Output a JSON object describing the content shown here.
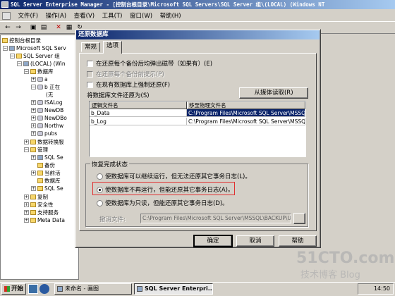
{
  "window": {
    "title": "SQL Server Enterprise Manager - [控制台根目录\\Microsoft SQL Servers\\SQL Server 组\\(LOCAL) (Windows NT"
  },
  "menu": [
    "文件(F)",
    "操作(A)",
    "查看(V)",
    "工具(T)",
    "窗口(W)",
    "帮助(H)"
  ],
  "tree": [
    {
      "label": "控制台根目录"
    },
    {
      "label": "Microsoft SQL Serv"
    },
    {
      "label": "SQL Server 组"
    },
    {
      "label": "(LOCAL) (Win"
    },
    {
      "label": "数据库"
    },
    {
      "label": "a"
    },
    {
      "label": "b  正在"
    },
    {
      "label": "(无"
    },
    {
      "label": "ISALog"
    },
    {
      "label": "NewDB"
    },
    {
      "label": "NewDBo"
    },
    {
      "label": "Northw"
    },
    {
      "label": "pubs"
    },
    {
      "label": "数据转换服"
    },
    {
      "label": "管理"
    },
    {
      "label": "SQL Se"
    },
    {
      "label": "备份"
    },
    {
      "label": "当前活"
    },
    {
      "label": "数据库"
    },
    {
      "label": "SQL Se"
    },
    {
      "label": "复制"
    },
    {
      "label": "安全性"
    },
    {
      "label": "支持服务"
    },
    {
      "label": "Meta Data"
    }
  ],
  "dialog": {
    "title": "还原数据库",
    "tabs": [
      "常规",
      "选项"
    ],
    "active_tab": "选项",
    "options": {
      "eject_tapes": {
        "label": "在还原每个备份后均弹出磁带（如果有）(E)",
        "checked": false
      },
      "prompt_tapes": {
        "label": "在还原每个备份前提示(P)",
        "checked": false
      },
      "force_restore": {
        "label": "在现有数据库上强制还原(F)",
        "checked": false
      }
    },
    "restore_as_label": "将数据库文件还原为(S)",
    "read_from_media_button": "从媒体读取(R)",
    "grid": {
      "headers": [
        "逻辑文件名",
        "移至物理文件名"
      ],
      "rows": [
        [
          "b_Data",
          "C:\\Program Files\\Microsoft SQL Server\\MSSQ"
        ],
        [
          "b_Log",
          "C:\\Program Files\\Microsoft SQL Server\\MSSQ"
        ]
      ]
    },
    "recovery": {
      "group_label": "恢复完成状态",
      "options": [
        "使数据库可以继续运行，但无法还原其它事务日志(L)。",
        "使数据库不再运行，但能还原其它事务日志(A)。",
        "使数据库为只读，但能还原其它事务日志(D)。"
      ],
      "selected_index": 1,
      "undo_label": "撤消文件:",
      "undo_value": "C:\\Program Files\\Microsoft SQL Server\\MSSQL\\BACKUP\\UNI"
    },
    "buttons": {
      "ok": "确定",
      "cancel": "取消",
      "help": "帮助"
    }
  },
  "taskbar": {
    "start": "开始",
    "tasks": [
      "未命名 - 画图",
      "SQL Server Enterpri..."
    ],
    "clock": "14:50"
  },
  "watermark": {
    "main": "51CTO.com",
    "sub": "技术博客  Blog"
  }
}
